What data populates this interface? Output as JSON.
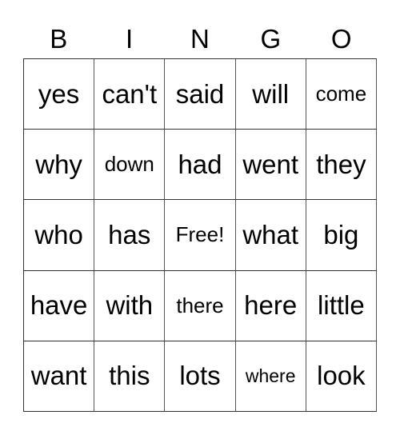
{
  "header": [
    "B",
    "I",
    "N",
    "G",
    "O"
  ],
  "rows": [
    [
      {
        "word": "yes",
        "size": "lg"
      },
      {
        "word": "can't",
        "size": "lg"
      },
      {
        "word": "said",
        "size": "lg"
      },
      {
        "word": "will",
        "size": "lg"
      },
      {
        "word": "come",
        "size": "sm"
      }
    ],
    [
      {
        "word": "why",
        "size": "lg"
      },
      {
        "word": "down",
        "size": "sm"
      },
      {
        "word": "had",
        "size": "lg"
      },
      {
        "word": "went",
        "size": "lg"
      },
      {
        "word": "they",
        "size": "lg"
      }
    ],
    [
      {
        "word": "who",
        "size": "lg"
      },
      {
        "word": "has",
        "size": "lg"
      },
      {
        "word": "Free!",
        "size": "sm"
      },
      {
        "word": "what",
        "size": "lg"
      },
      {
        "word": "big",
        "size": "lg"
      }
    ],
    [
      {
        "word": "have",
        "size": "lg"
      },
      {
        "word": "with",
        "size": "lg"
      },
      {
        "word": "there",
        "size": "sm"
      },
      {
        "word": "here",
        "size": "lg"
      },
      {
        "word": "little",
        "size": "lg"
      }
    ],
    [
      {
        "word": "want",
        "size": "lg"
      },
      {
        "word": "this",
        "size": "lg"
      },
      {
        "word": "lots",
        "size": "lg"
      },
      {
        "word": "where",
        "size": "xs"
      },
      {
        "word": "look",
        "size": "lg"
      }
    ]
  ]
}
